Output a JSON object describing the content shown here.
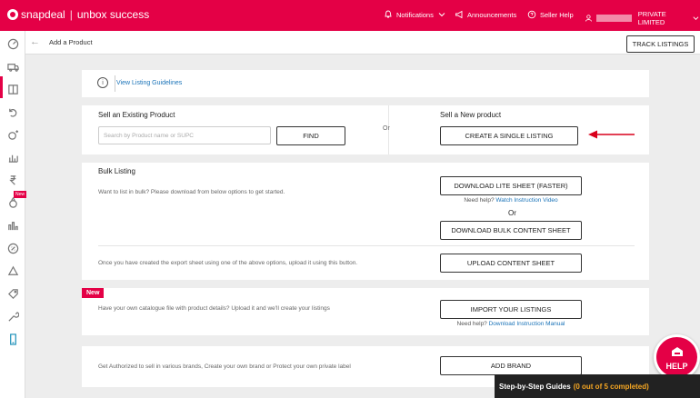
{
  "topbar": {
    "brand_name": "snapdeal",
    "brand_sep": "|",
    "brand_sub": "unbox success",
    "notifications": "Notifications",
    "announcements": "Announcements",
    "seller_help": "Seller Help",
    "account": "PRIVATE LIMITED",
    "accent_color": "#e40046"
  },
  "subbar": {
    "breadcrumb": "Add a Product",
    "track_listings": "TRACK LISTINGS"
  },
  "sidebar": {
    "icons": [
      "dashboard-icon",
      "truck-icon",
      "catalog-icon",
      "returns-icon",
      "promotions-icon",
      "analytics-icon",
      "payments-icon",
      "badge-icon",
      "reports-icon",
      "ads-icon",
      "recycle-icon",
      "tags-icon",
      "tools-icon",
      "mobile-icon"
    ],
    "new_badge": "New"
  },
  "guidelines": {
    "link": "View Listing Guidelines"
  },
  "sell": {
    "existing_title": "Sell an Existing Product",
    "search_placeholder": "Search by Product name or SUPC",
    "find": "FIND",
    "or": "Or",
    "new_title": "Sell a New product",
    "create_single": "CREATE A SINGLE LISTING"
  },
  "bulk": {
    "title": "Bulk Listing",
    "desc": "Want to list in bulk? Please download from below options to get started.",
    "download_lite": "DOWNLOAD LITE SHEET (FASTER)",
    "need_help": "Need help?",
    "watch_video": "Watch Instruction Video",
    "or": "Or",
    "download_bulk": "DOWNLOAD BULK CONTENT SHEET",
    "upload_desc": "Once you have created the export sheet using one of the above options, upload it using this button.",
    "upload": "UPLOAD CONTENT SHEET"
  },
  "import": {
    "badge": "New",
    "desc": "Have your own catalogue file with product details? Upload it and we'll create your listings",
    "button": "IMPORT YOUR LISTINGS",
    "need_help": "Need help?",
    "manual": "Download Instruction Manual"
  },
  "brand": {
    "desc": "Get Authorized to sell in various brands, Create your own brand or Protect your own private label",
    "button": "ADD BRAND"
  },
  "help": {
    "label": "HELP",
    "guides": "Step-by-Step Guides",
    "progress": "(0 out of 5 completed)"
  }
}
